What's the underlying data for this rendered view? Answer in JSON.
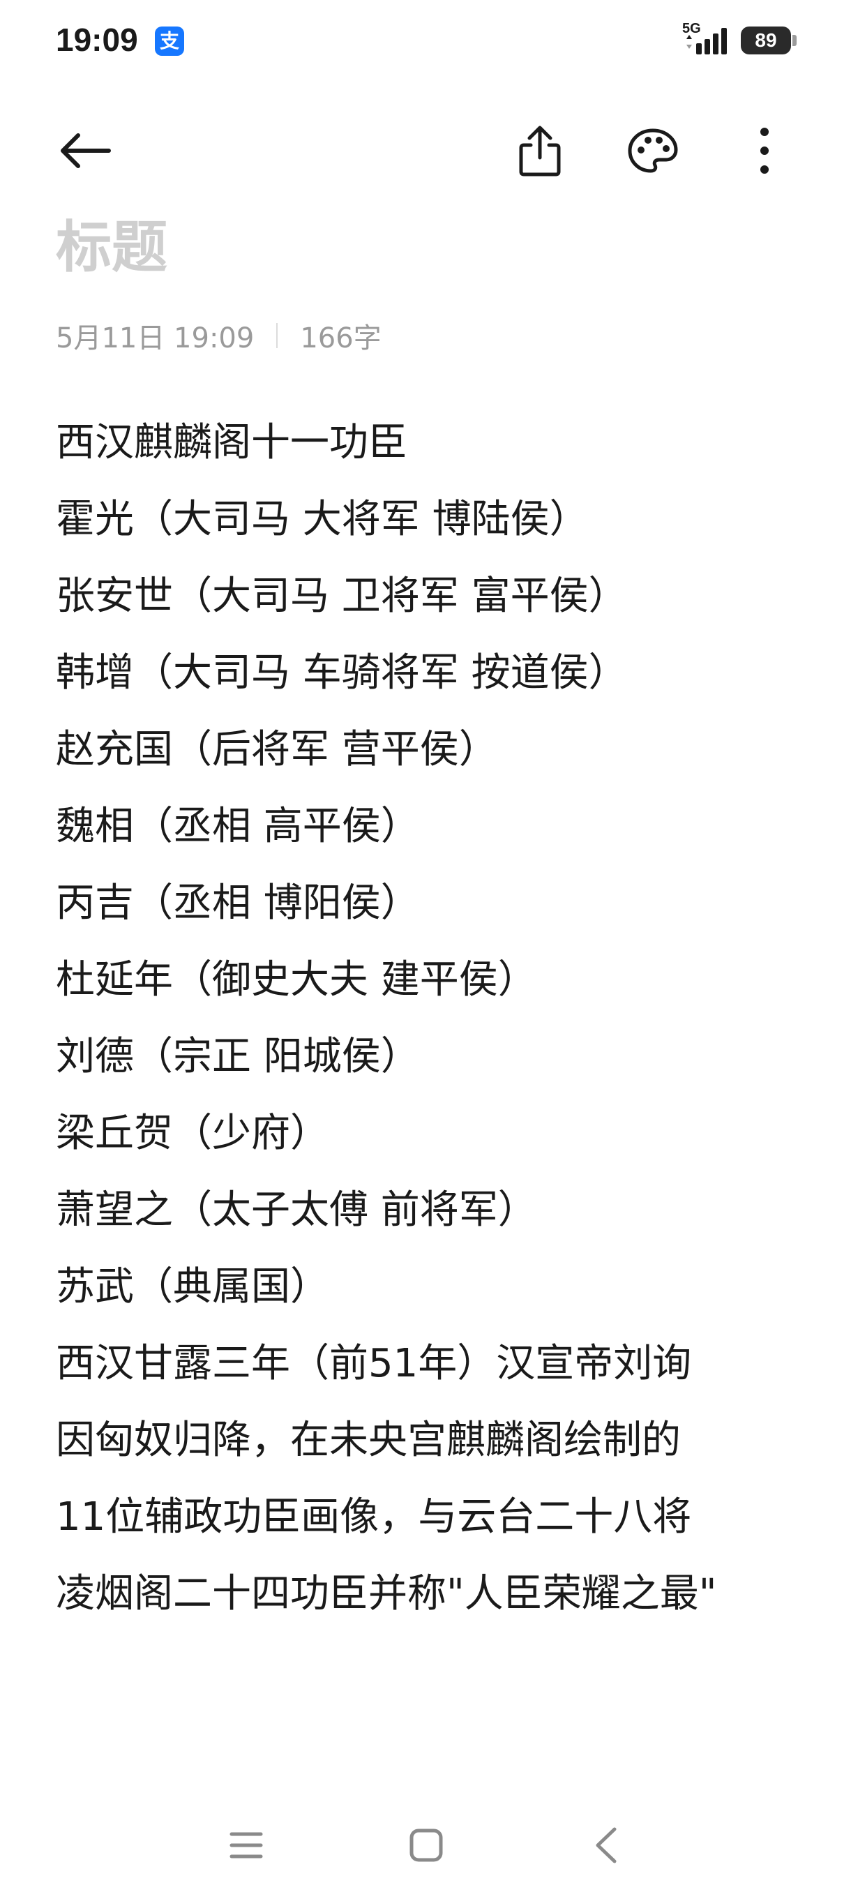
{
  "status_bar": {
    "time": "19:09",
    "app_badge": "支",
    "network": "5G",
    "battery": "89"
  },
  "toolbar": {
    "back_icon": "arrow-left-icon",
    "share_icon": "share-icon",
    "palette_icon": "palette-icon",
    "more_icon": "more-vertical-icon"
  },
  "note": {
    "title_placeholder": "标题",
    "date": "5月11日 19:09",
    "word_count": "166字",
    "lines": [
      "西汉麒麟阁十一功臣",
      "霍光（大司马 大将军 博陆侯）",
      "张安世（大司马 卫将军 富平侯）",
      "韩增（大司马 车骑将军 按道侯）",
      "赵充国（后将军 营平侯）",
      "魏相（丞相 高平侯）",
      "丙吉（丞相 博阳侯）",
      "杜延年（御史大夫 建平侯）",
      "刘德（宗正 阳城侯）",
      "梁丘贺（少府）",
      "萧望之（太子太傅 前将军）",
      "苏武（典属国）",
      "西汉甘露三年（前51年）汉宣帝刘询",
      "因匈奴归降，在未央宫麒麟阁绘制的",
      "11位辅政功臣画像，与云台二十八将",
      "凌烟阁二十四功臣并称\"人臣荣耀之最\""
    ]
  },
  "nav_bar": {
    "menu_icon": "menu-icon",
    "home_icon": "home-icon",
    "back_icon": "nav-back-icon"
  }
}
